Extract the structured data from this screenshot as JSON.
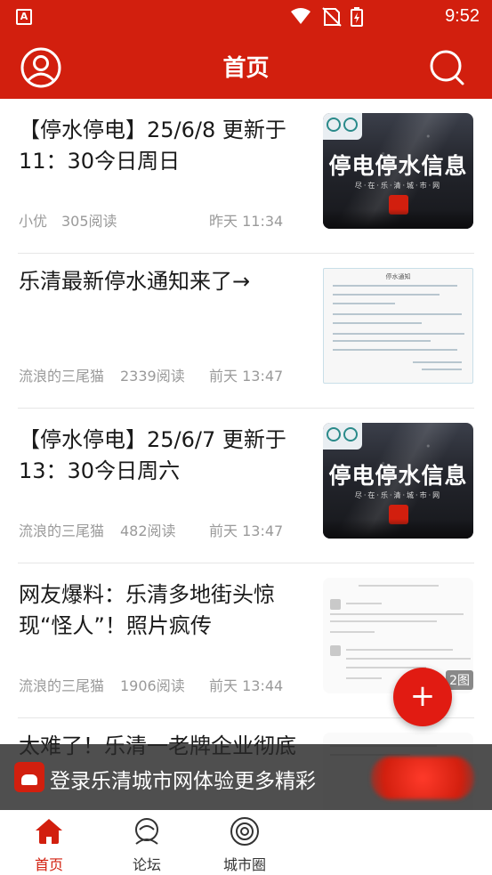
{
  "status_bar": {
    "time": "9:52",
    "app_icon_letter": "A",
    "icons": [
      "wifi-icon",
      "no-sim-icon",
      "battery-charging-icon"
    ]
  },
  "header": {
    "title": "首页",
    "left_icon": "user-icon",
    "right_icon": "search-icon"
  },
  "feed": [
    {
      "title": "【停水停电】25/6/8 更新于11：30今日周日",
      "author": "小优",
      "reads": "305阅读",
      "date": "昨天 11:34",
      "thumb_type": "dark-poster",
      "thumb_text": "停电停水信息",
      "thumb_subtext": "尽·在·乐·清·城·市·网"
    },
    {
      "title": "乐清最新停水通知来了→",
      "author": "流浪的三尾猫",
      "reads": "2339阅读",
      "date": "前天 13:47",
      "thumb_type": "document",
      "thumb_text": "停水通知"
    },
    {
      "title": "【停水停电】25/6/7 更新于13：30今日周六",
      "author": "流浪的三尾猫",
      "reads": "482阅读",
      "date": "前天 13:47",
      "thumb_type": "dark-poster",
      "thumb_text": "停电停水信息",
      "thumb_subtext": "尽·在·乐·清·城·市·网"
    },
    {
      "title": "网友爆料：乐清多地街头惊现“怪人”！照片疯传",
      "author": "流浪的三尾猫",
      "reads": "1906阅读",
      "date": "前天 13:44",
      "thumb_type": "screenshot",
      "thumb_count": "2图"
    },
    {
      "title": "太难了！乐清一老牌企业彻底",
      "thumb_type": "screenshot"
    }
  ],
  "fab": {
    "label": "+"
  },
  "login_banner": {
    "text": "登录乐清城市网体验更多精彩"
  },
  "bottom_nav": [
    {
      "label": "首页",
      "icon": "home-icon",
      "active": true
    },
    {
      "label": "论坛",
      "icon": "forum-icon",
      "active": false
    },
    {
      "label": "城市圈",
      "icon": "city-circle-icon",
      "active": false
    }
  ],
  "colors": {
    "brand_red": "#d21f0e",
    "fab_red": "#e11b12",
    "meta_gray": "#9a9a9a"
  }
}
